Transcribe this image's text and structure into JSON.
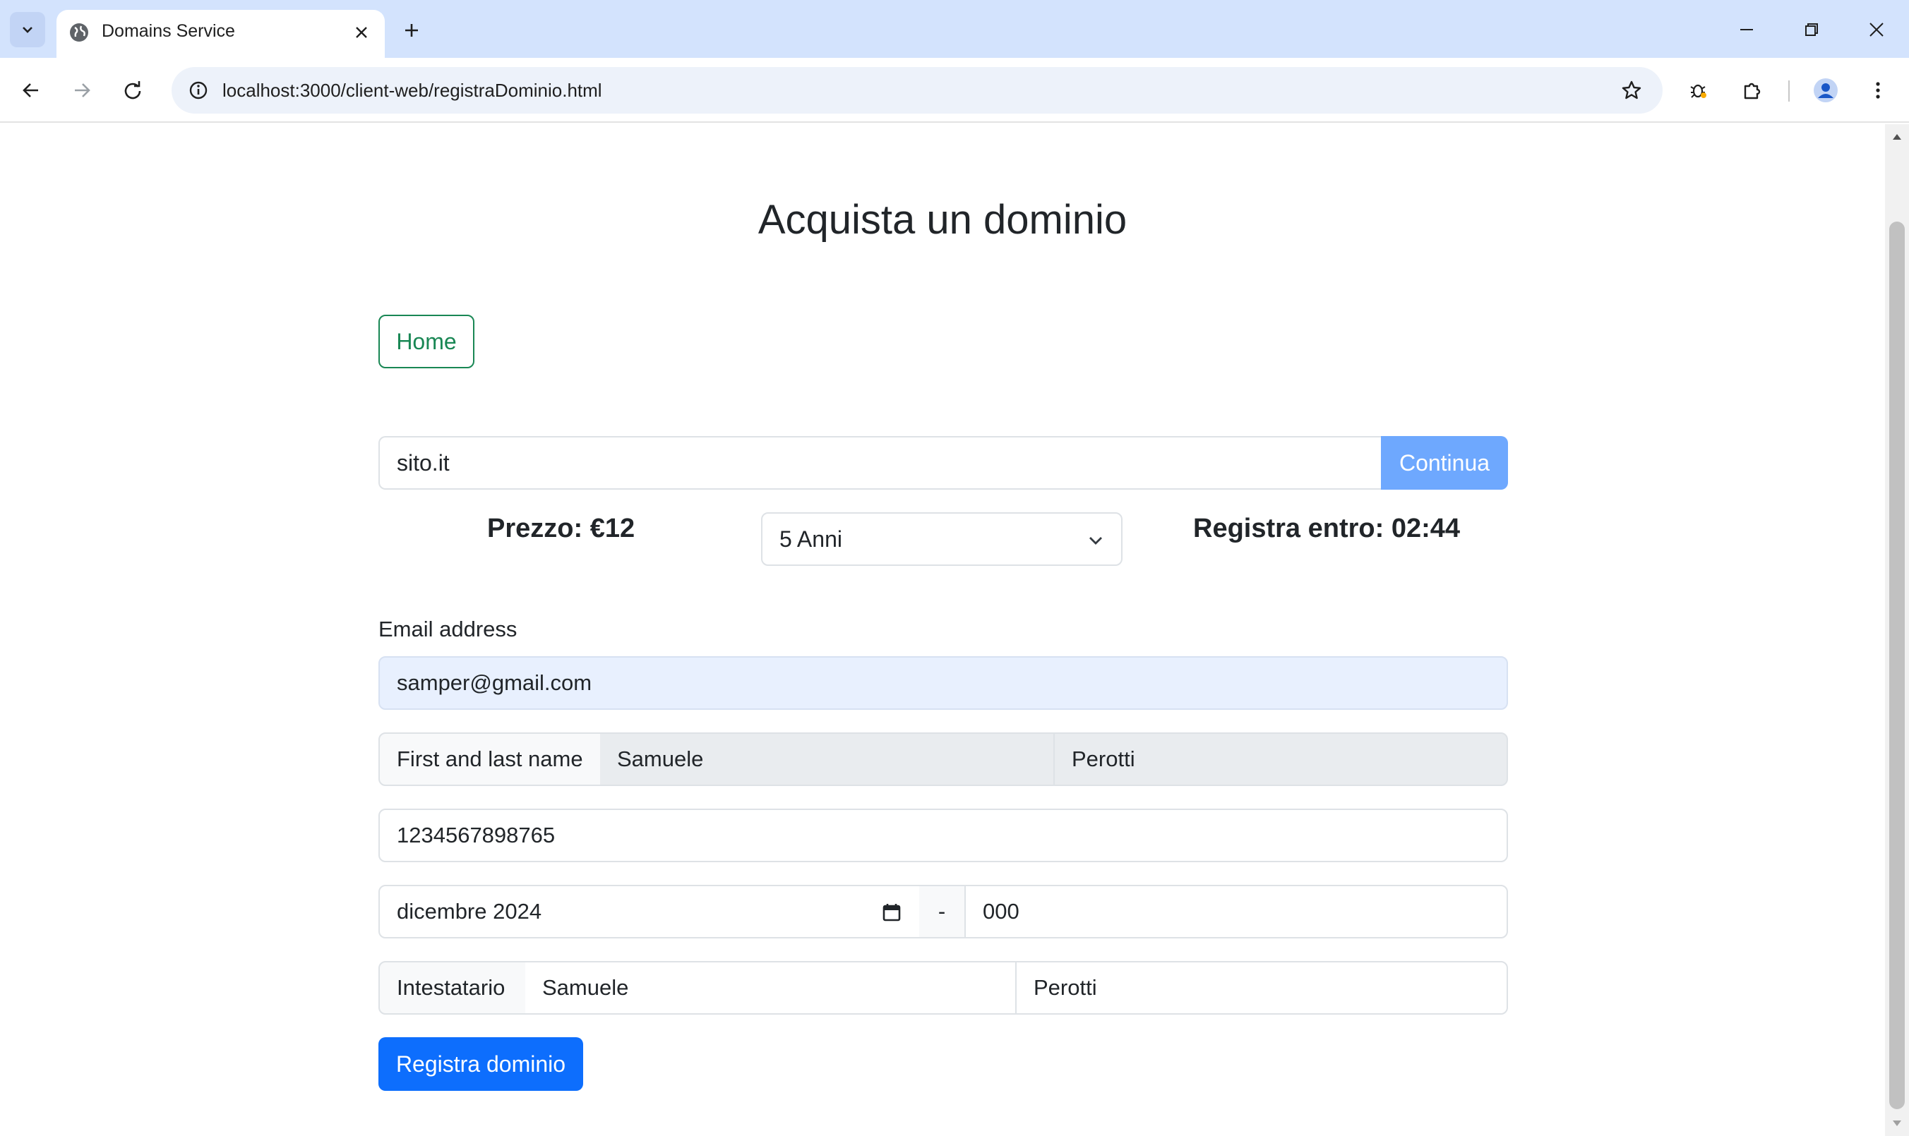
{
  "browser": {
    "tab_title": "Domains Service",
    "url": "localhost:3000/client-web/registraDominio.html"
  },
  "page": {
    "title": "Acquista un dominio",
    "home_label": "Home",
    "domain_value": "sito.it",
    "continue_label": "Continua",
    "price_text": "Prezzo: €12",
    "years_selected": "5 Anni",
    "deadline_text": "Registra entro: 02:44",
    "email_label": "Email address",
    "email_value": "samper@gmail.com",
    "name_label": "First and last name",
    "first_name": "Samuele",
    "last_name": "Perotti",
    "card_number": "1234567898765",
    "expiry_value": "dicembre 2024",
    "separator": "-",
    "cvv_value": "000",
    "holder_label": "Intestatario",
    "holder_first": "Samuele",
    "holder_last": "Perotti",
    "register_label": "Registra dominio"
  },
  "colors": {
    "tabstrip": "#d3e3fd",
    "primary": "#0d6efd",
    "primary_light": "#6ea8fe",
    "success": "#198754",
    "autofill": "#e8f0fe",
    "readonly": "#e9ecef"
  }
}
